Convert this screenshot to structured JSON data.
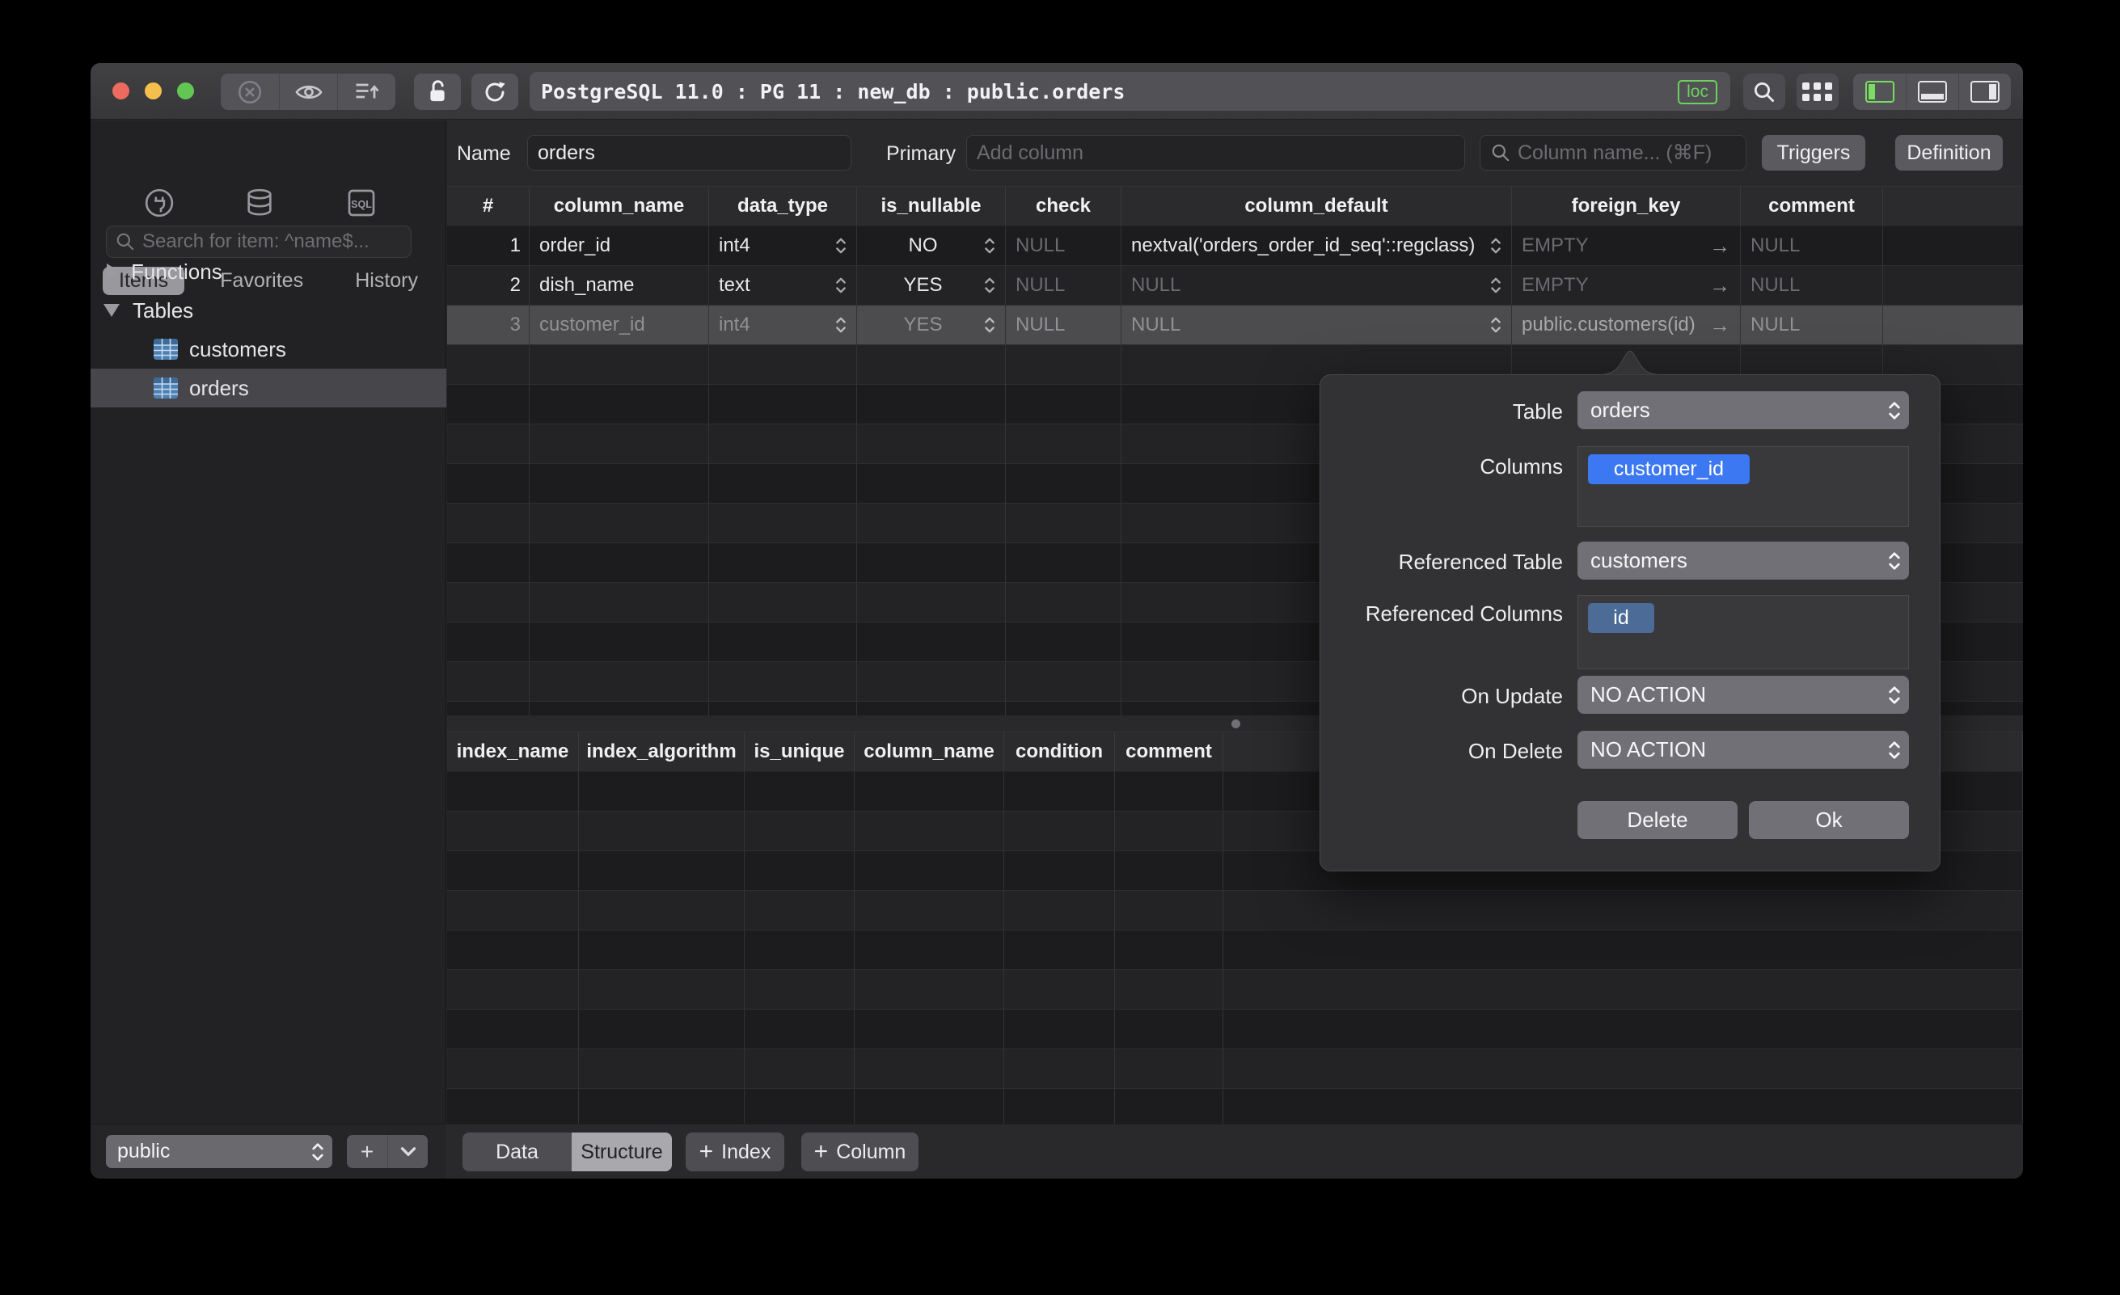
{
  "window": {
    "title": "PostgreSQL 11.0 : PG 11 : new_db : public.orders",
    "loc_badge": "loc"
  },
  "sidebar": {
    "search_placeholder": "Search for item: ^name$...",
    "tabs": {
      "items": "Items",
      "favorites": "Favorites",
      "history": "History"
    },
    "tree": {
      "functions_label": "Functions",
      "tables_label": "Tables",
      "tables": [
        {
          "name": "customers"
        },
        {
          "name": "orders"
        }
      ]
    },
    "schema_select_value": "public"
  },
  "main_topbar": {
    "name_label": "Name",
    "name_value": "orders",
    "primary_label": "Primary",
    "primary_placeholder": "Add column",
    "column_search_placeholder": "Column name... (⌘F)",
    "triggers_label": "Triggers",
    "definition_label": "Definition"
  },
  "structure_table": {
    "headers": [
      "#",
      "column_name",
      "data_type",
      "is_nullable",
      "check",
      "column_default",
      "foreign_key",
      "comment"
    ],
    "rows": [
      {
        "num": "1",
        "column_name": "order_id",
        "data_type": "int4",
        "is_nullable": "NO",
        "check": "NULL",
        "column_default": "nextval('orders_order_id_seq'::regclass)",
        "foreign_key": "EMPTY",
        "comment": "NULL"
      },
      {
        "num": "2",
        "column_name": "dish_name",
        "data_type": "text",
        "is_nullable": "YES",
        "check": "NULL",
        "column_default": "NULL",
        "foreign_key": "EMPTY",
        "comment": "NULL"
      },
      {
        "num": "3",
        "column_name": "customer_id",
        "data_type": "int4",
        "is_nullable": "YES",
        "check": "NULL",
        "column_default": "NULL",
        "foreign_key": "public.customers(id)",
        "comment": "NULL"
      }
    ]
  },
  "index_table": {
    "headers": [
      "index_name",
      "index_algorithm",
      "is_unique",
      "column_name",
      "condition",
      "comment"
    ]
  },
  "popover": {
    "table_label": "Table",
    "table_value": "orders",
    "columns_label": "Columns",
    "column_chip": "customer_id",
    "ref_table_label": "Referenced Table",
    "ref_table_value": "customers",
    "ref_columns_label": "Referenced Columns",
    "ref_column_chip": "id",
    "on_update_label": "On Update",
    "on_update_value": "NO ACTION",
    "on_delete_label": "On Delete",
    "on_delete_value": "NO ACTION",
    "delete_label": "Delete",
    "ok_label": "Ok"
  },
  "bottom_bar": {
    "data_tab": "Data",
    "structure_tab": "Structure",
    "index_button": "Index",
    "column_button": "Column"
  },
  "colors": {
    "accent_blue_chip": "#3b78f2",
    "ref_chip_blue": "#4c6b97",
    "loc_green": "#6ed15f",
    "panel_active_green": "#7bdd60",
    "traffic_red": "#ed6a5f",
    "traffic_yellow": "#f5bf4e",
    "traffic_green": "#62c554",
    "table_icon_blue": "#4d80b3",
    "highlight_row": "#4c4c4f"
  }
}
